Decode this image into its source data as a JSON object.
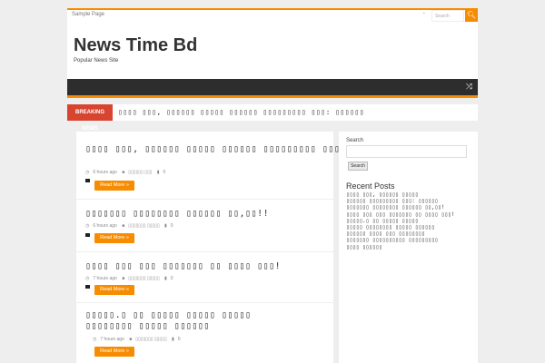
{
  "topbar": {
    "page_link": "Sample Page",
    "rss_icon": "rss-icon",
    "search_placeholder": "Search",
    "search_icon": "search-icon"
  },
  "header": {
    "title": "News Time Bd",
    "tagline": "Popular News Site"
  },
  "mainnav": {
    "shuffle_icon": "shuffle-icon"
  },
  "breaking": {
    "label": "BREAKING NEWS",
    "headline": "▯▯▯▯ ▯▯▯, ▯▯▯▯▯▯ ▯▯▯▯▯ ▯▯▯▯▯▯ ▯▯▯▯▯▯▯▯▯ ▯▯▯: ▯▯▯▯▯▯"
  },
  "posts": [
    {
      "title": "▯▯▯▯ ▯▯▯, ▯▯▯▯▯▯ ▯▯▯▯▯ ▯▯▯▯▯▯ ▯▯▯▯▯▯▯▯▯ ▯▯▯: ▯▯▯▯▯▯",
      "time": "6 hours ago",
      "category": "▯▯▯▯▯▯ ▯▯▯",
      "comments": "0",
      "more": "Read More »"
    },
    {
      "title": "▯▯▯▯▯▯▯ ▯▯▯▯▯▯▯▯ ▯▯▯▯▯▯ ▯▯,▯▯!!",
      "time": "6 hours ago",
      "category": "▯▯▯▯▯▯▯ ▯▯▯▯▯",
      "comments": "0",
      "more": "Read More »"
    },
    {
      "title": "▯▯▯▯ ▯▯▯ ▯▯▯ ▯▯▯▯▯▯▯ ▯▯ ▯▯▯▯ ▯▯▯!",
      "time": "7 hours ago",
      "category": "▯▯▯▯▯▯▯ ▯▯▯▯▯",
      "comments": "0",
      "more": "Read More »"
    },
    {
      "title": "▯▯▯▯▯.▯ ▯▯ ▯▯▯▯▯ ▯▯▯▯▯ ▯▯▯▯▯ ▯▯▯▯▯▯▯▯ ▯▯▯▯▯ ▯▯▯▯▯▯",
      "time": "7 hours ago",
      "category": "▯▯▯▯▯▯▯ ▯▯▯▯▯",
      "comments": "0",
      "more": "Read More »"
    }
  ],
  "sidebar": {
    "search_label": "Search",
    "search_button": "Search",
    "recent_title": "Recent Posts",
    "recent": [
      "▯▯▯▯ ▯▯▯, ▯▯▯▯▯▯ ▯▯▯▯▯",
      "▯▯▯▯▯▯ ▯▯▯▯▯▯▯▯▯ ▯▯▯: ▯▯▯▯▯▯",
      "▯▯▯▯▯▯▯ ▯▯▯▯▯▯▯▯ ▯▯▯▯▯▯ ▯▯,▯▯!",
      "▯▯▯▯ ▯▯▯ ▯▯▯ ▯▯▯▯▯▯▯ ▯▯ ▯▯▯▯ ▯▯▯!",
      "▯▯▯▯▯.▯ ▯▯ ▯▯▯▯▯ ▯▯▯▯▯",
      "▯▯▯▯▯ ▯▯▯▯▯▯▯▯ ▯▯▯▯▯ ▯▯▯▯▯▯",
      "▯▯▯▯▯▯ ▯▯▯▯ ▯▯▯ ▯▯▯▯▯▯▯▯",
      "▯▯▯▯▯▯▯ ▯▯▯▯▯▯▯▯▯▯ ▯▯▯▯▯▯▯▯▯",
      "▯▯▯▯ ▯▯▯▯▯▯"
    ]
  },
  "colors": {
    "accent": "#f88c00",
    "breaking": "#d74430",
    "nav": "#2d2d2d"
  }
}
